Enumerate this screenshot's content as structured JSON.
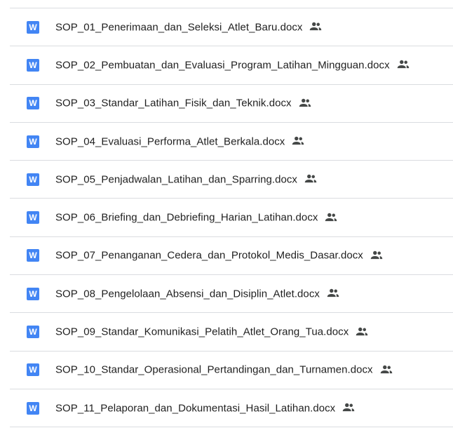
{
  "colors": {
    "word_icon": "#4285f4",
    "divider": "#dadce0",
    "text": "#1f1f1f",
    "shared_icon": "#444746"
  },
  "icons": {
    "file_type": "word-doc-icon",
    "shared": "shared-people-icon"
  },
  "file_type_letter": "W",
  "files": [
    {
      "name": "SOP_01_Penerimaan_dan_Seleksi_Atlet_Baru.docx"
    },
    {
      "name": "SOP_02_Pembuatan_dan_Evaluasi_Program_Latihan_Mingguan.docx"
    },
    {
      "name": "SOP_03_Standar_Latihan_Fisik_dan_Teknik.docx"
    },
    {
      "name": "SOP_04_Evaluasi_Performa_Atlet_Berkala.docx"
    },
    {
      "name": "SOP_05_Penjadwalan_Latihan_dan_Sparring.docx"
    },
    {
      "name": "SOP_06_Briefing_dan_Debriefing_Harian_Latihan.docx"
    },
    {
      "name": "SOP_07_Penanganan_Cedera_dan_Protokol_Medis_Dasar.docx"
    },
    {
      "name": "SOP_08_Pengelolaan_Absensi_dan_Disiplin_Atlet.docx"
    },
    {
      "name": "SOP_09_Standar_Komunikasi_Pelatih_Atlet_Orang_Tua.docx"
    },
    {
      "name": "SOP_10_Standar_Operasional_Pertandingan_dan_Turnamen.docx"
    },
    {
      "name": "SOP_11_Pelaporan_dan_Dokumentasi_Hasil_Latihan.docx"
    }
  ]
}
